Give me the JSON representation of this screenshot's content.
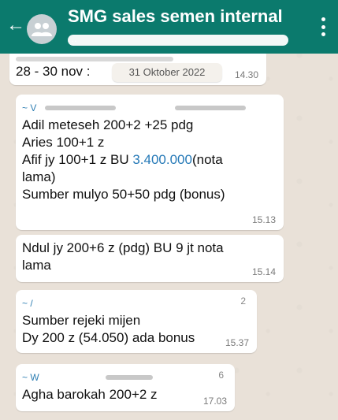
{
  "header": {
    "title": "SMG sales semen internal",
    "subtitle": "…"
  },
  "date_chip": "31 Oktober 2022",
  "messages": [
    {
      "lines": [
        "28 - 30 nov : "
      ],
      "time": "14.30"
    },
    {
      "sender": "~ V",
      "lines": [
        "Adil meteseh 200+2 +25 pdg",
        "Aries 100+1 z",
        "Afif jy 100+1 z BU ",
        "lama)",
        "Sumber mulyo 50+50 pdg (bonus)"
      ],
      "amount": "3.400.000",
      "amount_suffix": "(nota",
      "time": "15.13"
    },
    {
      "lines": [
        "Ndul jy 200+6 z (pdg) BU 9 jt nota",
        "lama"
      ],
      "time": "15.14"
    },
    {
      "sender": "~ /",
      "sender_tail": "2",
      "lines": [
        "Sumber rejeki mijen",
        "Dy 200 z (54.050) ada bonus"
      ],
      "time": "15.37"
    },
    {
      "sender": "~ W",
      "sender_tail": "6",
      "lines": [
        "Agha barokah 200+2 z"
      ],
      "time": "17.03"
    }
  ],
  "icons": {
    "back": "arrow-left-icon",
    "avatar": "group-avatar-icon",
    "menu": "more-vert-icon"
  },
  "colors": {
    "header": "#0b7a6d",
    "bubble": "#ffffff",
    "link": "#2579b7",
    "background": "#e9e1d8"
  }
}
